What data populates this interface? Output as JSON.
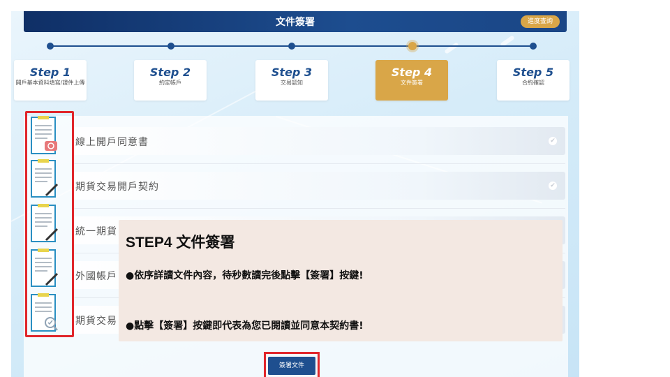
{
  "header": {
    "title": "文件簽署",
    "progress_button": "進度查詢",
    "accent_color": "#1e4f8f",
    "highlight_color": "#d9a648"
  },
  "steps": [
    {
      "title": "Step 1",
      "subtitle": "開戶基本資料填寫/證件上傳",
      "active": false
    },
    {
      "title": "Step 2",
      "subtitle": "約定帳戶",
      "active": false
    },
    {
      "title": "Step 3",
      "subtitle": "交易認知",
      "active": false
    },
    {
      "title": "Step 4",
      "subtitle": "文件簽署",
      "active": true
    },
    {
      "title": "Step 5",
      "subtitle": "合約確認",
      "active": false
    }
  ],
  "documents": [
    {
      "label": "線上開戶同意書",
      "icon": "document-e-stamp-icon",
      "status_icon": "checkmark-icon"
    },
    {
      "label": "期貨交易開戶契約",
      "icon": "document-pen-icon",
      "status_icon": "checkmark-icon"
    },
    {
      "label": "統一期貨",
      "icon": "document-pen-icon",
      "status_icon": "checkmark-icon"
    },
    {
      "label": "外國帳戶",
      "icon": "document-pen-icon",
      "status_icon": "checkmark-icon"
    },
    {
      "label": "期貨交易",
      "icon": "document-magnifier-icon",
      "status_icon": "checkmark-icon"
    }
  ],
  "sign_button": "簽署文件",
  "callout": {
    "title": "STEP4 文件簽署",
    "line1": "●依序詳讀文件內容，待秒數讀完後點擊【簽署】按鍵!",
    "line2": "●點擊【簽署】按鍵即代表為您已閱讀並同意本契約書!"
  },
  "highlight_border_color": "#e0262b"
}
